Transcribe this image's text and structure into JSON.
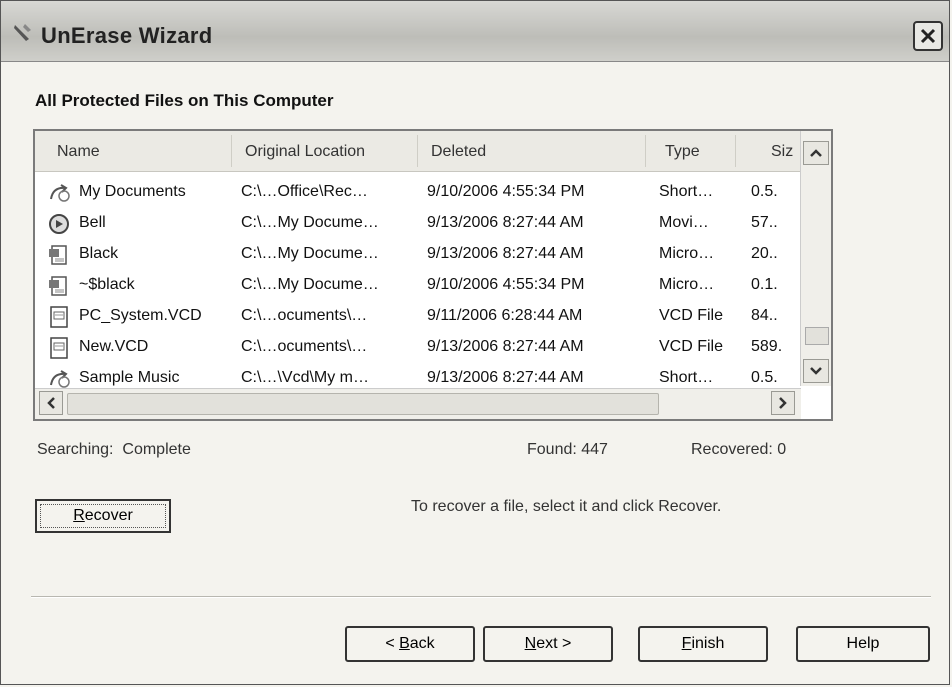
{
  "window": {
    "title": "UnErase Wizard"
  },
  "heading": "All Protected Files on This Computer",
  "columns": [
    "Name",
    "Original Location",
    "Deleted",
    "Type",
    "Siz"
  ],
  "files": [
    {
      "name": "My Documents",
      "location": "C:\\…Office\\Rec…",
      "deleted": "9/10/2006 4:55:34 PM",
      "type": "Short…",
      "size": "0.5.",
      "icon": "shortcut-icon"
    },
    {
      "name": "Bell",
      "location": "C:\\…My Docume…",
      "deleted": "9/13/2006 8:27:44 AM",
      "type": "Movi…",
      "size": "57..",
      "icon": "movie-icon"
    },
    {
      "name": "Black",
      "location": "C:\\…My Docume…",
      "deleted": "9/13/2006 8:27:44 AM",
      "type": "Micro…",
      "size": "20..",
      "icon": "word-document-icon"
    },
    {
      "name": "~$black",
      "location": "C:\\…My Docume…",
      "deleted": "9/10/2006 4:55:34 PM",
      "type": "Micro…",
      "size": "0.1.",
      "icon": "word-document-icon"
    },
    {
      "name": "PC_System.VCD",
      "location": "C:\\…ocuments\\…",
      "deleted": "9/11/2006 6:28:44 AM",
      "type": "VCD File",
      "size": "84..",
      "icon": "vcd-file-icon"
    },
    {
      "name": "New.VCD",
      "location": "C:\\…ocuments\\…",
      "deleted": "9/13/2006 8:27:44 AM",
      "type": "VCD File",
      "size": "589.",
      "icon": "vcd-file-icon"
    },
    {
      "name": "Sample Music",
      "location": "C:\\…\\Vcd\\My m…",
      "deleted": "9/13/2006 8:27:44 AM",
      "type": "Short…",
      "size": "0.5.",
      "icon": "shortcut-icon"
    }
  ],
  "status": {
    "searching_label": "Searching:",
    "searching_value": "Complete",
    "found": "Found: 447",
    "recovered": "Recovered: 0"
  },
  "recover_button": {
    "mnemonic": "R",
    "rest": "ecover"
  },
  "hint": "To recover a file, select it and click Recover.",
  "buttons": {
    "back_prefix": "< ",
    "back_mnemonic": "B",
    "back_rest": "ack",
    "next_mnemonic": "N",
    "next_rest": "ext >",
    "finish_mnemonic": "F",
    "finish_rest": "inish",
    "help": "Help"
  }
}
